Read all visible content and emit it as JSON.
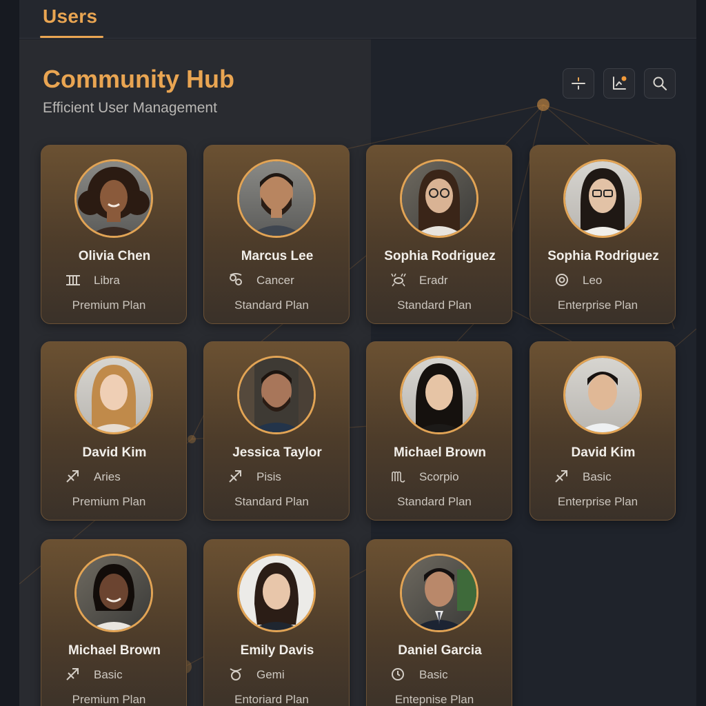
{
  "header": {
    "tab_label": "Users"
  },
  "page": {
    "title": "Community Hub",
    "subtitle": "Efficient User Management"
  },
  "toolbar": [
    {
      "icon": "filter-icon",
      "label": "Filter"
    },
    {
      "icon": "chart-icon",
      "label": "Analytics"
    },
    {
      "icon": "search-icon",
      "label": "Search"
    }
  ],
  "colors": {
    "accent": "#e9a552",
    "card_border": "#6c5236",
    "background": "#1b1e26",
    "notification_dot": "#f29a3a"
  },
  "users": [
    {
      "name": "Olivia Chen",
      "sign": "Libra",
      "sign_icon": "libra-icon",
      "plan": "Premium Plan",
      "avatar": "avatar-woman-curly-hair"
    },
    {
      "name": "Marcus Lee",
      "sign": "Cancer",
      "sign_icon": "cancer-icon",
      "plan": "Standard Plan",
      "avatar": "avatar-man-beard"
    },
    {
      "name": "Sophia Rodriguez",
      "sign": "Eradr",
      "sign_icon": "crab-icon",
      "plan": "Standard Plan",
      "avatar": "avatar-woman-glasses"
    },
    {
      "name": "Sophia Rodriguez",
      "sign": "Leo",
      "sign_icon": "leo-icon",
      "plan": "Enterprise Plan",
      "avatar": "avatar-woman-glasses-2"
    },
    {
      "name": "David Kim",
      "sign": "Aries",
      "sign_icon": "sagittarius-icon",
      "plan": "Premium Plan",
      "avatar": "avatar-woman-blonde"
    },
    {
      "name": "Jessica Taylor",
      "sign": "Pisis",
      "sign_icon": "sagittarius-icon",
      "plan": "Standard Plan",
      "avatar": "avatar-man-beard-2"
    },
    {
      "name": "Michael Brown",
      "sign": "Scorpio",
      "sign_icon": "scorpio-icon",
      "plan": "Standard Plan",
      "avatar": "avatar-woman-dark-hair"
    },
    {
      "name": "David Kim",
      "sign": "Basic",
      "sign_icon": "sagittarius-icon",
      "plan": "Enterprise Plan",
      "avatar": "avatar-man-young"
    },
    {
      "name": "Michael Brown",
      "sign": "Basic",
      "sign_icon": "sagittarius-icon",
      "plan": "Premium Plan",
      "avatar": "avatar-woman-smiling"
    },
    {
      "name": "Emily Davis",
      "sign": "Gemi",
      "sign_icon": "taurus-icon",
      "plan": "Entoriard Plan",
      "avatar": "avatar-woman-brunette"
    },
    {
      "name": "Daniel Garcia",
      "sign": "Basic",
      "sign_icon": "clock-icon",
      "plan": "Entepnise Plan",
      "avatar": "avatar-man-suit"
    }
  ]
}
